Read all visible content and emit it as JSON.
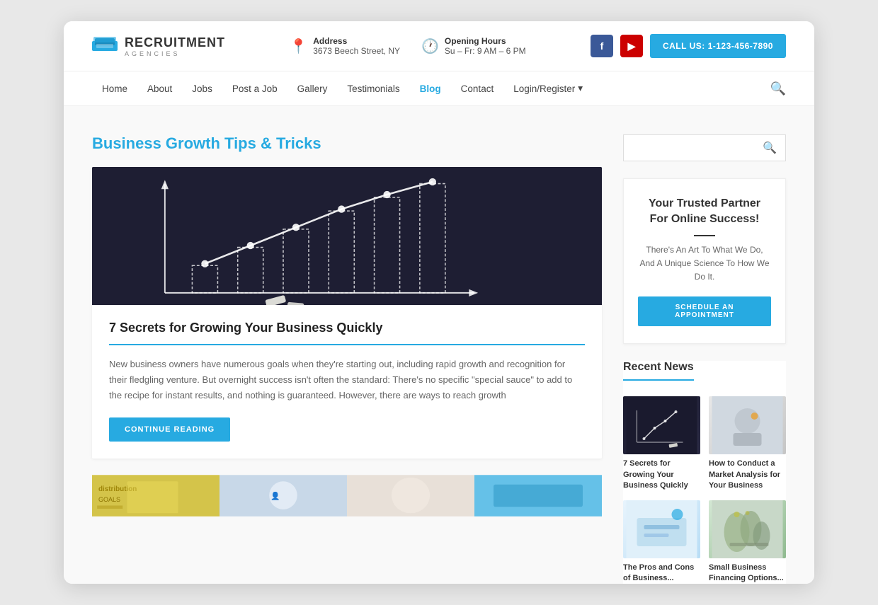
{
  "browser": {
    "background": "#e8e8e8"
  },
  "header": {
    "logo_main": "RECRUITMENT",
    "logo_sub": "AGENCIES",
    "address_label": "Address",
    "address_value": "3673 Beech Street, NY",
    "hours_label": "Opening Hours",
    "hours_value": "Su – Fr: 9 AM – 6 PM",
    "call_btn": "CALL US: 1-123-456-7890"
  },
  "nav": {
    "items": [
      {
        "label": "Home",
        "active": false
      },
      {
        "label": "About",
        "active": false
      },
      {
        "label": "Jobs",
        "active": false
      },
      {
        "label": "Post a Job",
        "active": false
      },
      {
        "label": "Gallery",
        "active": false
      },
      {
        "label": "Testimonials",
        "active": false
      },
      {
        "label": "Blog",
        "active": true
      },
      {
        "label": "Contact",
        "active": false
      },
      {
        "label": "Login/Register",
        "active": false,
        "has_arrow": true
      }
    ]
  },
  "page": {
    "title": "Business Growth Tips & Tricks"
  },
  "blog_post": {
    "title": "7 Secrets for Growing Your Business Quickly",
    "excerpt": "New business owners have numerous goals when they're starting out, including rapid growth and recognition for their fledgling venture. But overnight success isn't often the standard: There's no specific \"special sauce\" to add to the recipe for instant results, and nothing is guaranteed. However, there are ways to reach growth",
    "continue_btn": "CONTINUE READING"
  },
  "sidebar": {
    "search_placeholder": "",
    "widget": {
      "title": "Your Trusted Partner For Online Success!",
      "description": "There's An Art To What We Do, And A Unique Science To How We Do It.",
      "schedule_btn": "SCHEDULE AN APPOINTMENT"
    },
    "recent_news": {
      "title": "Recent News",
      "items": [
        {
          "label": "7 Secrets for Growing Your Business Quickly",
          "thumb": "dark"
        },
        {
          "label": "How to Conduct a Market Analysis for Your Business",
          "thumb": "light"
        },
        {
          "label": "The Pros and Cons of Business...",
          "thumb": "blue"
        },
        {
          "label": "Small Business Financing Options...",
          "thumb": "green"
        }
      ]
    }
  }
}
